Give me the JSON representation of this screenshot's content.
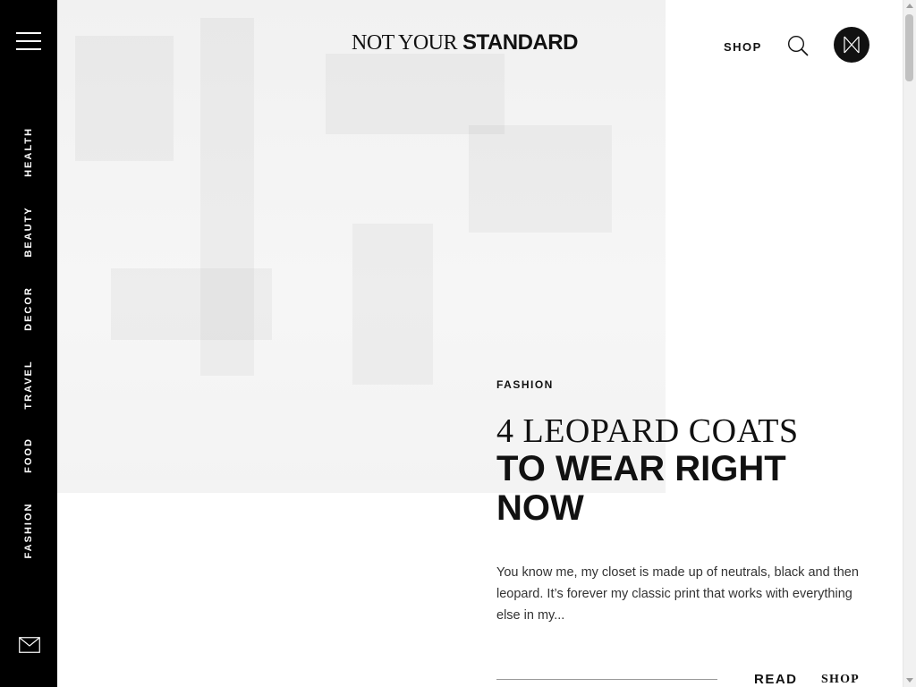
{
  "header": {
    "logo_serif": "NOT YOUR",
    "logo_sans": "STANDARD",
    "shop_label": "SHOP",
    "icons": [
      "menu-icon",
      "search-icon",
      "brand-monogram-icon",
      "mail-icon"
    ]
  },
  "sidebar": {
    "items": [
      {
        "label": "HEALTH"
      },
      {
        "label": "BEAUTY"
      },
      {
        "label": "DECOR"
      },
      {
        "label": "TRAVEL"
      },
      {
        "label": "FOOD"
      },
      {
        "label": "FASHION"
      }
    ]
  },
  "article": {
    "category": "FASHION",
    "title_line1": "4 LEOPARD COATS",
    "title_line2": "TO WEAR RIGHT NOW",
    "excerpt": "You know me, my closet is made up of neutrals, black and then leopard. It’s forever my classic print that works with everything else in my...",
    "read_label": "READ",
    "shop_label": "SHOP"
  },
  "colors": {
    "sidebar_bg": "#000000",
    "text": "#111111",
    "hero_placeholder": "#f3f3f3"
  }
}
